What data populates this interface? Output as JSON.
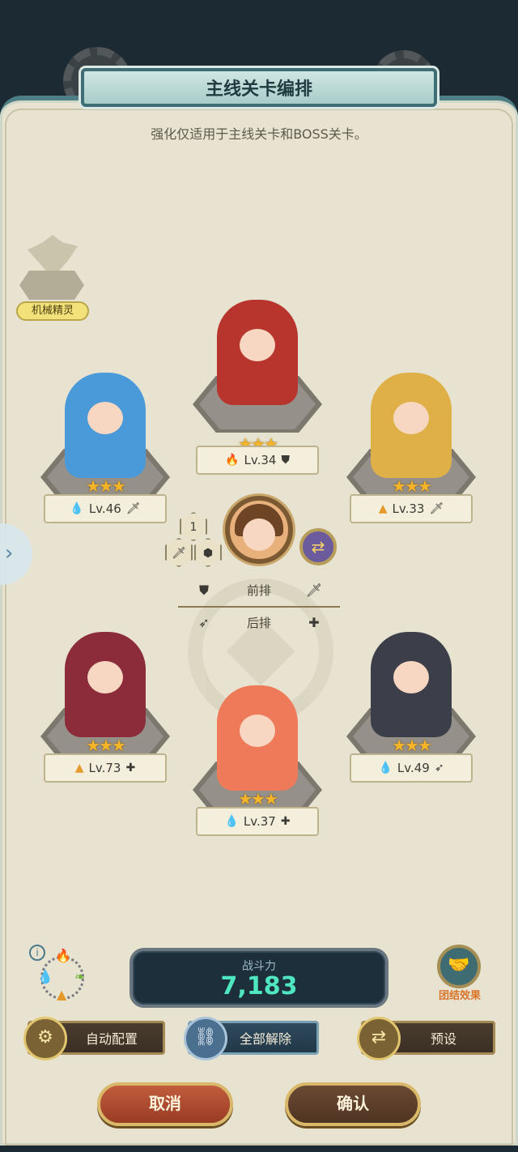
{
  "header": {
    "title": "主线关卡编排",
    "subtitle": "强化仅适用于主线关卡和BOSS关卡。"
  },
  "boss": {
    "label": "机械精灵"
  },
  "heroes": [
    {
      "id": "top-center",
      "level": "Lv.34",
      "stars": "★★★",
      "element": "fire",
      "element_glyph": "🔥",
      "role_glyph": "⛊",
      "role": "shield",
      "color": "#b8352e"
    },
    {
      "id": "top-left",
      "level": "Lv.46",
      "stars": "★★★",
      "element": "water",
      "element_glyph": "💧",
      "role_glyph": "🗡",
      "role": "sword",
      "color": "#4a9ad9"
    },
    {
      "id": "top-right",
      "level": "Lv.33",
      "stars": "★★★",
      "element": "earth",
      "element_glyph": "▲",
      "role_glyph": "🗡",
      "role": "sword",
      "color": "#e0b048"
    },
    {
      "id": "bottom-left",
      "level": "Lv.73",
      "stars": "★★★",
      "element": "earth",
      "element_glyph": "▲",
      "role_glyph": "✚",
      "role": "support",
      "color": "#8c2c3a"
    },
    {
      "id": "bottom-center",
      "level": "Lv.37",
      "stars": "★★★",
      "element": "water",
      "element_glyph": "💧",
      "role_glyph": "✚",
      "role": "support",
      "color": "#ef7a5a"
    },
    {
      "id": "bottom-right",
      "level": "Lv.49",
      "stars": "★★★",
      "element": "water",
      "element_glyph": "💧",
      "role_glyph": "➶",
      "role": "archer",
      "color": "#3c3f4a"
    }
  ],
  "leader": {
    "slot_number": "1",
    "swap_glyph": "⇄"
  },
  "rows": {
    "front_label": "前排",
    "back_label": "后排"
  },
  "power": {
    "label": "战斗力",
    "value": "7,183"
  },
  "bond": {
    "label": "团结效果"
  },
  "actions": {
    "auto": "自动配置",
    "release": "全部解除",
    "preset": "预设"
  },
  "footer": {
    "cancel": "取消",
    "confirm": "确认"
  },
  "colors": {
    "panel": "#e7e3d0",
    "accent": "#4f7f86",
    "power_value": "#4fe7c0",
    "star": "#f4b52a"
  }
}
